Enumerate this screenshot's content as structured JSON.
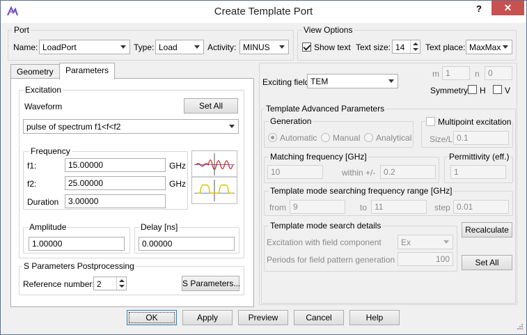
{
  "window": {
    "title": "Create Template Port",
    "help": "?",
    "close": "✕"
  },
  "port": {
    "group_title": "Port",
    "name_label": "Name:",
    "name_value": "LoadPort",
    "type_label": "Type:",
    "type_value": "Load",
    "activity_label": "Activity:",
    "activity_value": "MINUS"
  },
  "view_options": {
    "group_title": "View Options",
    "show_text_label": "Show text",
    "text_size_label": "Text size:",
    "text_size_value": "14",
    "text_place_label": "Text place:",
    "text_place_value": "MaxMax"
  },
  "tabs": [
    {
      "label": "Geometry"
    },
    {
      "label": "Parameters"
    }
  ],
  "excitation": {
    "group_title": "Excitation",
    "waveform_label": "Waveform",
    "set_all": "Set All",
    "waveform_value": "pulse of spectrum f1<f<f2",
    "frequency_title": "Frequency",
    "f1_label": "f1:",
    "f1_value": "15.00000",
    "f1_unit": "GHz",
    "f2_label": "f2:",
    "f2_value": "25.00000",
    "f2_unit": "GHz",
    "duration_label": "Duration",
    "duration_value": "3.00000",
    "amplitude_title": "Amplitude",
    "amplitude_value": "1.00000",
    "delay_title": "Delay [ns]",
    "delay_value": "0.00000"
  },
  "sparams": {
    "group_title": "S Parameters Postprocessing",
    "ref_label": "Reference number:",
    "ref_value": "2",
    "button": "S Parameters..."
  },
  "right": {
    "exciting_field_label": "Exciting field",
    "exciting_field_value": "TEM",
    "m_label": "m",
    "m_value": "1",
    "n_label": "n",
    "n_value": "0",
    "symmetry_label": "Symmetry",
    "h_label": "H",
    "v_label": "V"
  },
  "advanced": {
    "group_title": "Template Advanced Parameters",
    "generation_title": "Generation",
    "automatic": "Automatic",
    "manual": "Manual",
    "analytical": "Analytical",
    "multipoint_label": "Multipoint excitation",
    "size_label": "Size/L",
    "size_value": "0.1",
    "matching_title": "Matching frequency [GHz]",
    "matching_value": "10",
    "within_label": "within +/-",
    "within_value": "0.2",
    "permittivity_title": "Permittivity (eff.)",
    "permittivity_value": "1",
    "range_title": "Template mode searching frequency range [GHz]",
    "from_label": "from",
    "from_value": "9",
    "to_label": "to",
    "to_value": "11",
    "step_label": "step",
    "step_value": "0.01",
    "search_title": "Template mode search details",
    "excite_comp_label": "Excitation with field component",
    "excite_comp_value": "Ex",
    "periods_label": "Periods for field pattern generation",
    "periods_value": "100",
    "recalculate": "Recalculate",
    "set_all": "Set All"
  },
  "footer": {
    "ok": "OK",
    "apply": "Apply",
    "preview": "Preview",
    "cancel": "Cancel",
    "help": "Help"
  }
}
